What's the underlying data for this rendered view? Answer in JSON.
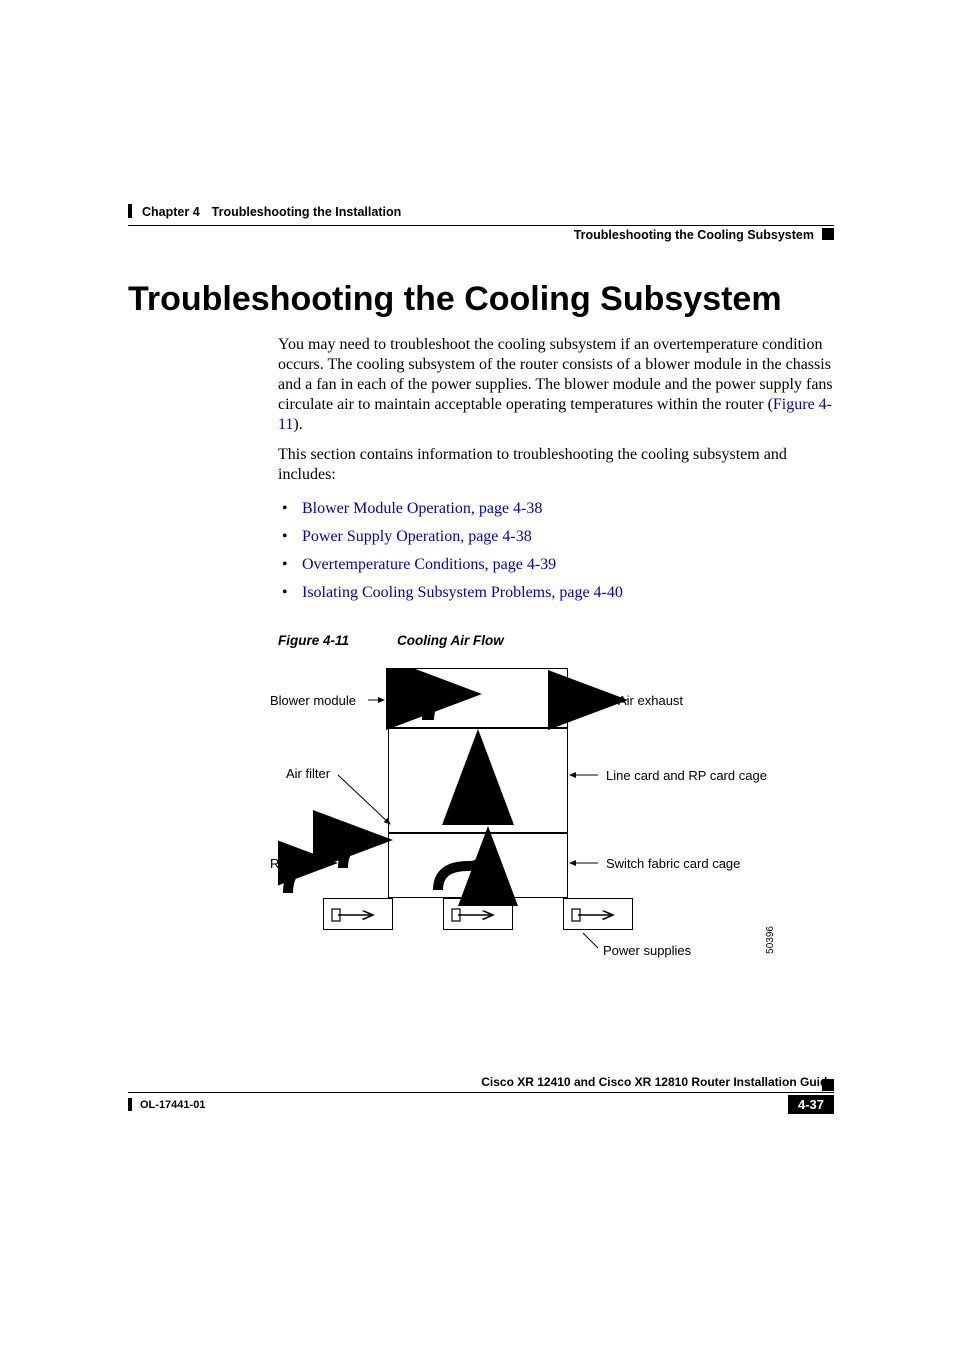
{
  "header": {
    "chapter_num": "Chapter 4",
    "chapter_title": "Troubleshooting the Installation",
    "section_title": "Troubleshooting the Cooling Subsystem"
  },
  "heading": "Troubleshooting the Cooling Subsystem",
  "paragraphs": {
    "p1_a": "You may need to troubleshoot the cooling subsystem if an overtemperature condition occurs. The cooling subsystem of the router consists of a blower module in the chassis and a fan in each of the power supplies. The blower module and the power supply fans circulate air to maintain acceptable operating temperatures within the router (",
    "p1_link": "Figure 4-11",
    "p1_b": ").",
    "p2": "This section contains information to troubleshooting the cooling subsystem and includes:"
  },
  "bullets": [
    "Blower Module Operation, page 4-38",
    "Power Supply Operation, page 4-38",
    "Overtemperature Conditions, page 4-39",
    "Isolating Cooling Subsystem Problems, page 4-40"
  ],
  "figure": {
    "number": "Figure 4-11",
    "title": "Cooling Air Flow",
    "labels": {
      "blower_module": "Blower module",
      "air_filter": "Air filter",
      "room_air": "Room air",
      "air_exhaust": "Air exhaust",
      "line_card": "Line card and RP card cage",
      "switch_fabric": "Switch fabric card cage",
      "power_supplies": "Power supplies"
    },
    "image_id": "50396"
  },
  "footer": {
    "guide": "Cisco XR 12410 and Cisco XR 12810 Router Installation Guide",
    "doc_id": "OL-17441-01",
    "page": "4-37"
  }
}
